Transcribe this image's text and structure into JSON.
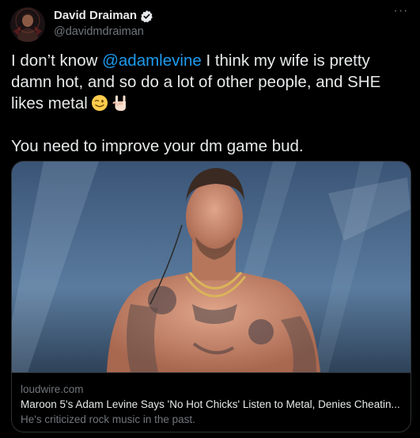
{
  "author": {
    "display_name": "David Draiman",
    "handle": "@davidmdraiman",
    "verified": true
  },
  "more_label": "···",
  "tweet": {
    "text_1": "I don’t know ",
    "mention": "@adamlevine",
    "text_2": " I think my wife is pretty damn hot, and so do a lot of other people, and SHE likes metal",
    "emojis": [
      "winking-face",
      "sign-of-the-horns"
    ],
    "text_3": "You need to improve your dm game bud."
  },
  "card": {
    "domain": "loudwire.com",
    "title": "Maroon 5's Adam Levine Says 'No Hot Chicks' Listen to Metal, Denies Cheatin...",
    "description": "He's criticized rock music in the past.",
    "image": "shirtless-tattooed-performer-on-stage"
  },
  "colors": {
    "background": "#000000",
    "text": "#e7e9ea",
    "secondary": "#71767b",
    "accent": "#1d9bf0",
    "border": "#2f3336"
  }
}
